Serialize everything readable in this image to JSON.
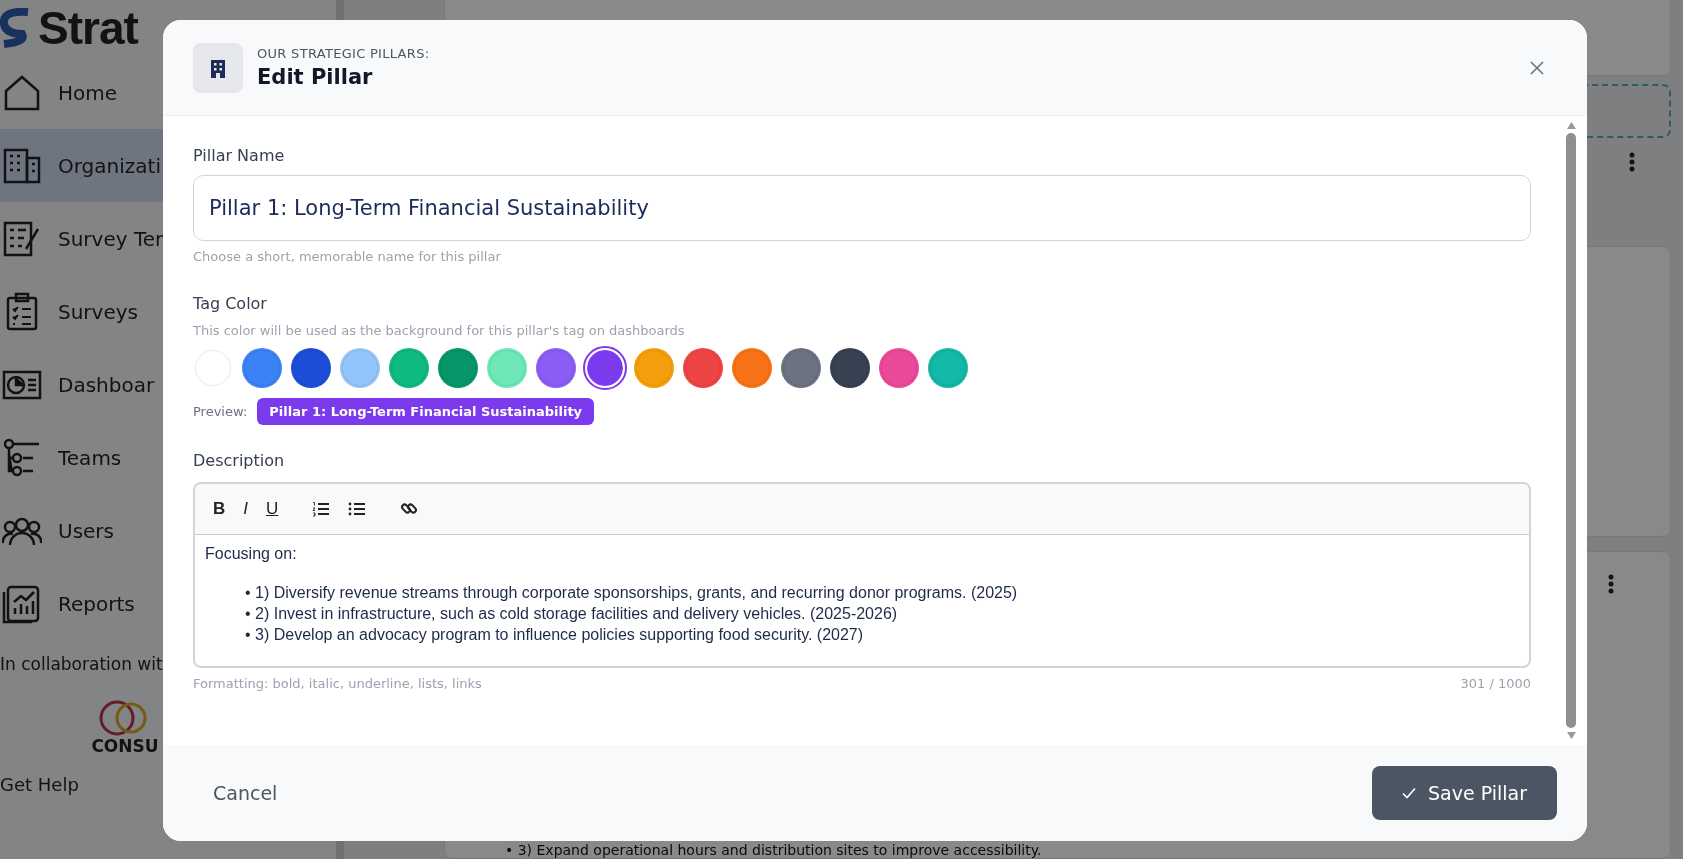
{
  "sidebar": {
    "logo_text": "Strat",
    "items": [
      {
        "label": "Home",
        "selected": false
      },
      {
        "label": "Organizati",
        "selected": true
      },
      {
        "label": "Survey Ter",
        "selected": false
      },
      {
        "label": "Surveys",
        "selected": false
      },
      {
        "label": "Dashboar",
        "selected": false
      },
      {
        "label": "Teams",
        "selected": false
      },
      {
        "label": "Users",
        "selected": false
      },
      {
        "label": "Reports",
        "selected": false
      }
    ],
    "collaboration_text": "In collaboration wit",
    "partner_logo_text": "CONSU",
    "help_link": "Get Help"
  },
  "background": {
    "bottom_text": "• 3) Expand operational hours and distribution sites to improve accessibility."
  },
  "modal": {
    "eyebrow": "OUR STRATEGIC PILLARS:",
    "title": "Edit Pillar",
    "name_label": "Pillar Name",
    "name_value": "Pillar 1: Long-Term Financial Sustainability",
    "name_hint": "Choose a short, memorable name for this pillar",
    "color_label": "Tag Color",
    "color_hint": "This color will be used as the background for this pillar's tag on dashboards",
    "swatches": [
      {
        "color": "#ffffff",
        "selected": false
      },
      {
        "color": "#3b82f6",
        "selected": false
      },
      {
        "color": "#1d4ed8",
        "selected": false
      },
      {
        "color": "#93c5fd",
        "selected": false
      },
      {
        "color": "#10b981",
        "selected": false
      },
      {
        "color": "#059669",
        "selected": false
      },
      {
        "color": "#6ee7b7",
        "selected": false
      },
      {
        "color": "#8b5cf6",
        "selected": false
      },
      {
        "color": "#7c3aed",
        "selected": true
      },
      {
        "color": "#f59e0b",
        "selected": false
      },
      {
        "color": "#ef4444",
        "selected": false
      },
      {
        "color": "#f97316",
        "selected": false
      },
      {
        "color": "#6b7280",
        "selected": false
      },
      {
        "color": "#374151",
        "selected": false
      },
      {
        "color": "#ec4899",
        "selected": false
      },
      {
        "color": "#14b8a6",
        "selected": false
      }
    ],
    "preview_label": "Preview:",
    "preview_tag": "Pillar 1: Long-Term Financial Sustainability",
    "description_label": "Description",
    "toolbar_letters": [
      "B",
      "I",
      "U"
    ],
    "description_intro": "Focusing on:",
    "description_items": [
      "• 1) Diversify revenue streams through corporate sponsorships, grants, and recurring donor programs. (2025)",
      "• 2) Invest in infrastructure, such as cold storage facilities and delivery vehicles. (2025-2026)",
      "• 3) Develop an advocacy program to influence policies supporting food security. (2027)"
    ],
    "formatting_hint": "Formatting: bold, italic, underline, lists, links",
    "char_count": "301 / 1000",
    "cancel": "Cancel",
    "save": "Save Pillar"
  }
}
